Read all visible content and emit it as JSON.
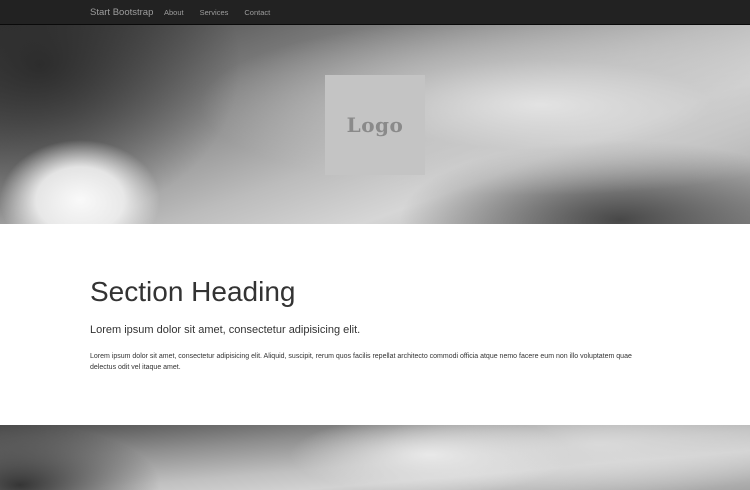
{
  "navbar": {
    "brand": "Start Bootstrap",
    "links": [
      {
        "label": "About"
      },
      {
        "label": "Services"
      },
      {
        "label": "Contact"
      }
    ]
  },
  "hero": {
    "logo_text": "Logo"
  },
  "section": {
    "heading": "Section Heading",
    "lead": "Lorem ipsum dolor sit amet, consectetur adipisicing elit.",
    "body": "Lorem ipsum dolor sit amet, consectetur adipisicing elit. Aliquid, suscipit, rerum quos facilis repellat architecto commodi officia atque nemo facere eum non illo voluptatem quae delectus odit vel itaque amet."
  },
  "colors": {
    "navbar_bg": "#222222",
    "nav_text": "#9d9d9d",
    "logo_bg": "#c4c4c4",
    "text": "#333333"
  }
}
